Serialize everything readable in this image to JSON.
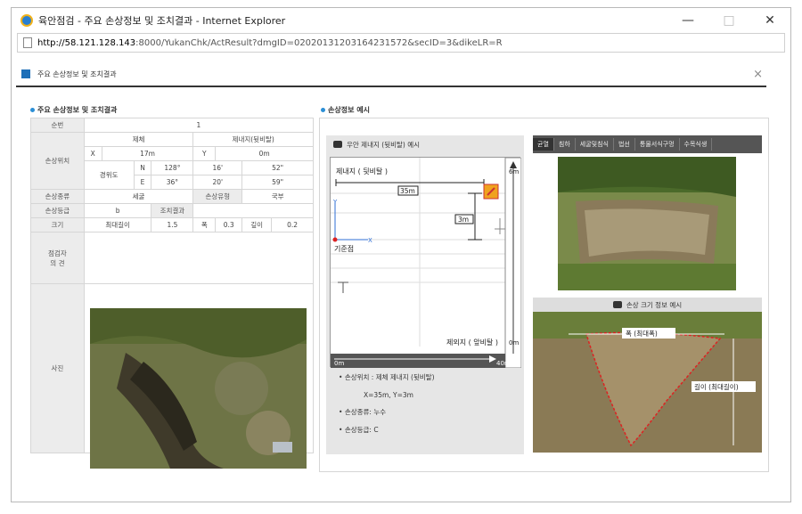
{
  "window": {
    "title": "육안점검 - 주요 손상정보 및 조치결과 - Internet Explorer",
    "url_host": "http://58.121.128.143",
    "url_rest": ":8000/YukanChk/ActResult?dmgID=02020131203164231572&secID=3&dikeLR=R",
    "btn_min": "—",
    "btn_max": "□",
    "btn_close": "✕"
  },
  "popup": {
    "title": "주요 손상정보 및 조치결과",
    "close": "×"
  },
  "left": {
    "section_title": "주요 손상정보 및 조치결과",
    "rows": {
      "seq_label": "순번",
      "seq_value": "1",
      "loc_label": "손상위치",
      "dike_head": "제체",
      "dike_sub_head": "제내지(뒷비탈)",
      "x_label": "X",
      "x_value": "17m",
      "y_label": "Y",
      "y_value": "0m",
      "latlon_label": "경위도",
      "n_label": "N",
      "n_deg": "128°",
      "n_min": "16'",
      "n_sec": "52\"",
      "e_label": "E",
      "e_deg": "36°",
      "e_min": "20'",
      "e_sec": "59\"",
      "type_label": "손상종류",
      "type_value": "세굴",
      "form_label": "손상유형",
      "form_value": "국부",
      "grade_label": "손상등급",
      "grade_value": "b",
      "action_label": "조치결과",
      "action_value": "",
      "size_label": "크기",
      "maxlen_label": "최대길이",
      "maxlen_value": "1.5",
      "width_label": "폭",
      "width_value": "0.3",
      "depth_label": "깊이",
      "depth_value": "0.2",
      "opinion_label": "점검자\n의 견",
      "photo_label": "사진"
    }
  },
  "right": {
    "section_title": "손상정보 예시",
    "example1_title": "우안 제내지 (뒷비탈) 예시",
    "diagram": {
      "top_label": "제내지 ( 뒷비탈 )",
      "dist_label": "35m",
      "height_label": "3m",
      "origin_label": "기준점",
      "bottom_label": "제외지 ( 앞비탈 )",
      "axis_x_start": "0m",
      "axis_x_end": "40m",
      "axis_y_top": "6m",
      "axis_y_bottom": "0m",
      "x_axis_letter": "X",
      "y_axis_letter": "Y"
    },
    "notes": [
      "손상위치 : 제체 제내지 (뒷비탈)",
      "X=35m, Y=3m",
      "손상종류: 누수",
      "손상등급: C"
    ],
    "tabs": [
      "균열",
      "침하",
      "세굴및침식",
      "법선",
      "통물서식구멍",
      "수목식생"
    ],
    "example2_title": "손상 크기 정보 예시",
    "size_width_label": "폭 (최대폭)",
    "size_depth_label": "길이 (최대길이)"
  }
}
